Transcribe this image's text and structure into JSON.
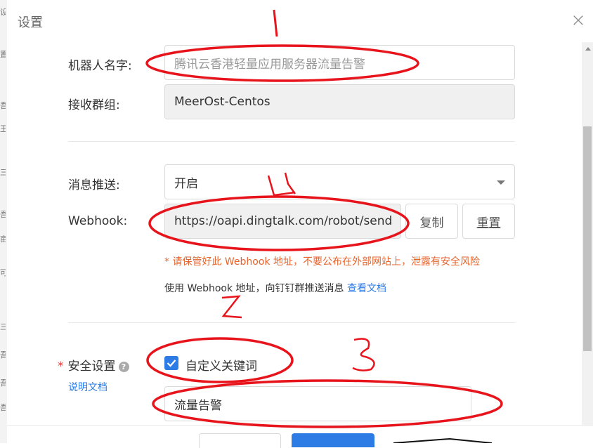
{
  "background": {
    "chars": [
      "设",
      "置",
      "吾",
      "王",
      "三",
      "吾",
      "亩",
      "可",
      "三",
      "吾",
      "吾",
      "吾"
    ]
  },
  "dialog": {
    "title": "设置",
    "close_icon": "×"
  },
  "form": {
    "robot_name_label": "机器人名字:",
    "robot_name_value": "腾讯云香港轻量应用服务器流量告警",
    "group_label": "接收群组:",
    "group_value": "MeerOst-Centos",
    "push_label": "消息推送:",
    "push_value": "开启",
    "webhook_label": "Webhook:",
    "webhook_value": "https://oapi.dingtalk.com/robot/send",
    "copy_button": "复制",
    "reset_button": "重置",
    "webhook_warning": "* 请保管好此 Webhook 地址，不要公布在外部网站上，泄露有安全风险",
    "webhook_hint": "使用 Webhook 地址，向钉钉群推送消息",
    "docs_link": "查看文档",
    "security_required_mark": "*",
    "security_label": "安全设置",
    "help_icon": "?",
    "security_docs_link": "说明文档",
    "keyword_checkbox_label": "自定义关键词",
    "keyword_checked": true,
    "keyword_value": "流量告警"
  },
  "annotations": {
    "one": "1",
    "two": "2",
    "three": "3",
    "four": "4"
  },
  "colors": {
    "accent": "#2d7be5",
    "warning": "#e5632c",
    "annotation": "#e8141c"
  }
}
